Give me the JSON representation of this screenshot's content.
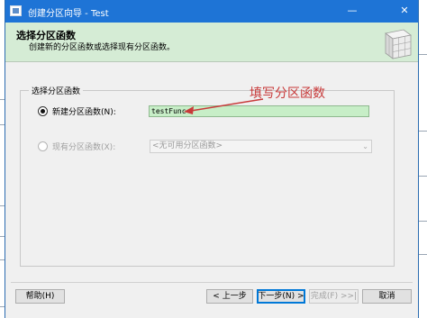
{
  "window": {
    "title": "创建分区向导 - Test"
  },
  "titlebar": {
    "minimize_glyph": "—",
    "close_glyph": "✕"
  },
  "header": {
    "title": "选择分区函数",
    "subtitle": "创建新的分区函数或选择现有分区函数。"
  },
  "group": {
    "label": "选择分区函数"
  },
  "options": {
    "new_function_label": "新建分区函数(N):",
    "new_function_value": "testFunc",
    "existing_function_label": "现有分区函数(X):",
    "existing_function_value": "<无可用分区函数>"
  },
  "annotation": {
    "text": "填写分区函数",
    "color": "#c83a3a"
  },
  "buttons": {
    "help": "帮助(H)",
    "back": "< 上一步",
    "next": "下一步(N) >",
    "finish": "完成(F) >>|",
    "cancel": "取消"
  },
  "colors": {
    "titlebar": "#1e74d6",
    "header_bg": "#d5ecd5",
    "input_bg": "#c7eec7"
  }
}
